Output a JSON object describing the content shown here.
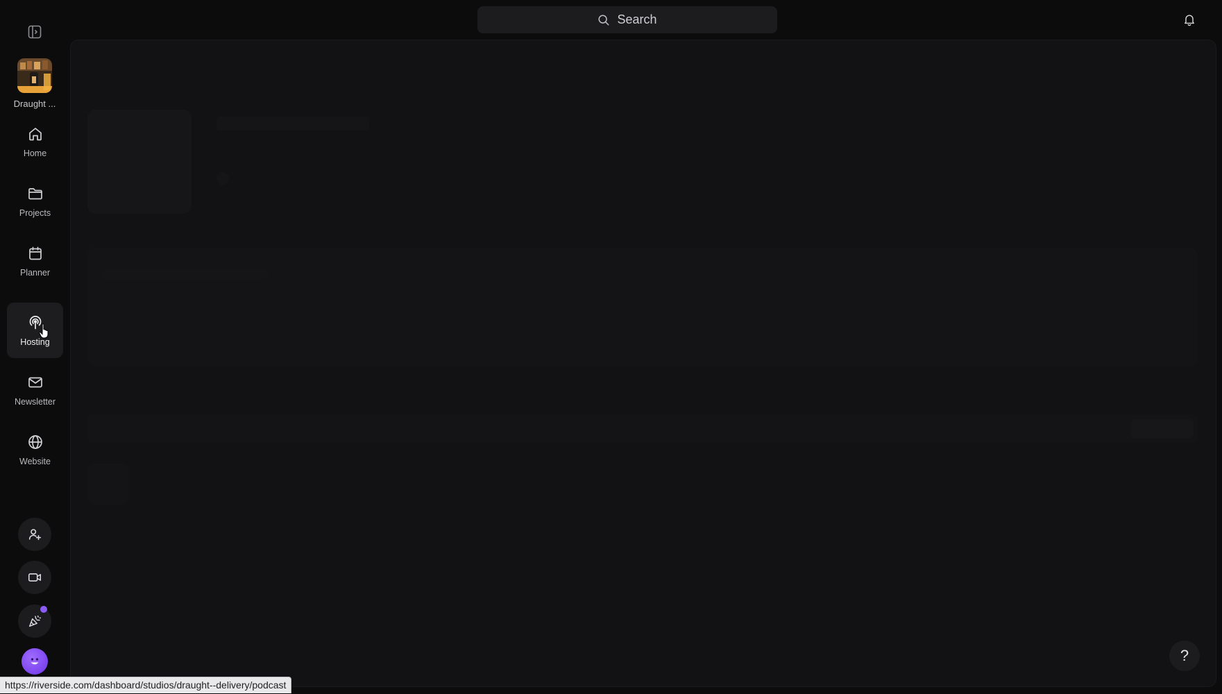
{
  "sidebar": {
    "studio": {
      "name": "Draught ..."
    },
    "items": [
      {
        "label": "Home",
        "icon": "home-icon"
      },
      {
        "label": "Projects",
        "icon": "folder-icon"
      },
      {
        "label": "Planner",
        "icon": "calendar-icon"
      },
      {
        "label": "Hosting",
        "icon": "podcast-icon",
        "active": true
      },
      {
        "label": "Newsletter",
        "icon": "mail-icon"
      },
      {
        "label": "Website",
        "icon": "globe-icon"
      }
    ],
    "bottom_buttons": [
      {
        "icon": "add-user-icon"
      },
      {
        "icon": "video-camera-icon"
      },
      {
        "icon": "party-popper-icon",
        "badge": true
      }
    ],
    "accent_color": "#8b5cf6"
  },
  "header": {
    "search": {
      "placeholder": "Search"
    }
  },
  "help": {
    "label": "?"
  },
  "status_bar": {
    "url": "https://riverside.com/dashboard/studios/draught--delivery/podcast"
  }
}
